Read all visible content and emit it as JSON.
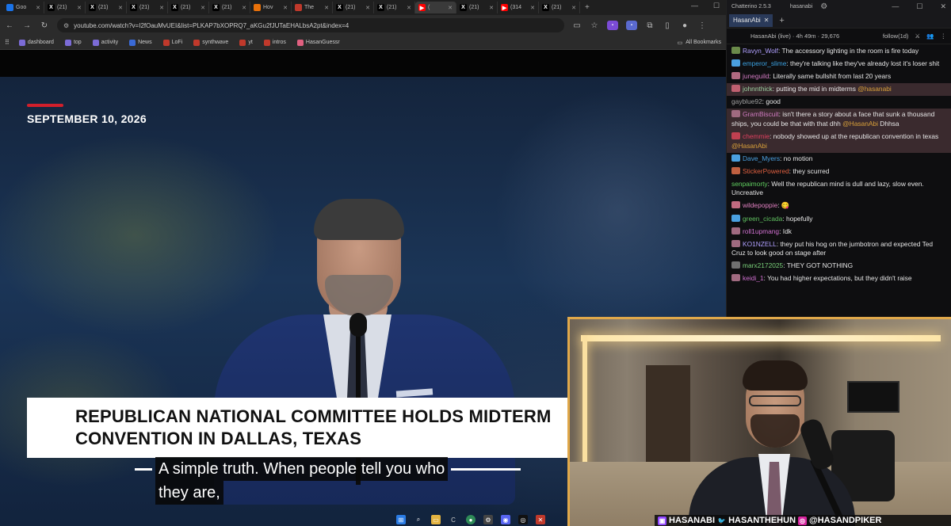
{
  "browser": {
    "tabs": [
      {
        "label": "Goo",
        "icon": "google-icon",
        "color": "#1a73e8"
      },
      {
        "label": "(21)",
        "icon": "x-icon",
        "color": "#000000"
      },
      {
        "label": "(21)",
        "icon": "x-icon",
        "color": "#000000"
      },
      {
        "label": "(21)",
        "icon": "x-icon",
        "color": "#000000"
      },
      {
        "label": "(21)",
        "icon": "x-icon",
        "color": "#000000"
      },
      {
        "label": "(21)",
        "icon": "x-icon",
        "color": "#000000"
      },
      {
        "label": "Hov",
        "icon": "orange-icon",
        "color": "#e8710a"
      },
      {
        "label": "The",
        "icon": "red-pin-icon",
        "color": "#c0392b"
      },
      {
        "label": "(21)",
        "icon": "x-icon",
        "color": "#000000"
      },
      {
        "label": "(21)",
        "icon": "x-icon",
        "color": "#000000"
      },
      {
        "label": "(",
        "icon": "youtube-icon",
        "color": "#ff0000",
        "active": true
      },
      {
        "label": "(21)",
        "icon": "x-icon",
        "color": "#000000"
      },
      {
        "label": "(314",
        "icon": "youtube-icon",
        "color": "#ff0000"
      },
      {
        "label": "(21)",
        "icon": "x-icon",
        "color": "#000000"
      }
    ],
    "url": "youtube.com/watch?v=I2fOauMvUEI&list=PLKAP7bXOPRQ7_aKGu2fJUTaEHALbsA2pt&index=4",
    "bookmarks": [
      "dashboard",
      "top",
      "activity",
      "News",
      "LoFi",
      "synthwave",
      "yt",
      "intros",
      "HasanGuessr"
    ],
    "all_bookmarks": "All Bookmarks"
  },
  "video": {
    "date": "SEPTEMBER 10, 2026",
    "lower_third": [
      "REPUBLICAN NATIONAL COMMITTEE HOLDS MIDTERM",
      "CONVENTION IN DALLAS, TEXAS"
    ],
    "caption": [
      "A simple truth. When people tell you who",
      "they are,"
    ]
  },
  "chat": {
    "app_title": "Chatterino 2.5.3",
    "account": "hasanabi",
    "tab_label": "HasanAbi",
    "header": "HasanAbi (live) · 4h 49m · 29,676",
    "follow": "follow(1d)",
    "messages": [
      {
        "user": "Ravyn_Wolf",
        "color": "#b0a0ff",
        "text": "The accessory lighting in the room is fire today",
        "badge": "#6a8a4a"
      },
      {
        "user": "emperor_slime",
        "color": "#3aa0e0",
        "text": "they're talking like they've already lost it's loser shit",
        "badge": "#4aa0e0"
      },
      {
        "user": "juneguild",
        "color": "#d07ac0",
        "text": "Literally same bullshit from last 20 years",
        "badge": "#b06a80"
      },
      {
        "user": "johnnthick",
        "color": "#9ad0a0",
        "text": "putting the mid in midterms ",
        "mention": "@hasanabi",
        "badge": "#c06070",
        "highlight": true
      },
      {
        "user": "gayblue92",
        "color": "#a0a0a0",
        "text": "good",
        "badge": ""
      },
      {
        "user": "GramBiscuit",
        "color": "#d07ac0",
        "text": "isn't there a story about a face that sunk a thousand ships, you could be that with that dhh ",
        "mention": "@HasanAbi",
        "tail": " Dhhsa",
        "badge": "#a06a80",
        "highlight": true
      },
      {
        "user": "chemmie",
        "color": "#e04060",
        "text": "nobody showed up at the republican convention in texas ",
        "mention": "@HasanAbi",
        "badge": "#c04050",
        "highlight": true
      },
      {
        "user": "Dave_Myers",
        "color": "#4aa0e0",
        "text": "no motion",
        "badge": "#4aa0e0"
      },
      {
        "user": "StickerPowered",
        "color": "#e06040",
        "text": "they scurred",
        "badge": "#c06040"
      },
      {
        "user": "senpaimorty",
        "color": "#60d060",
        "text": "Well the republican mind is dull and lazy, slow even. Uncreative",
        "badge": ""
      },
      {
        "user": "wildepoppie",
        "color": "#e080c0",
        "text": "😋",
        "badge": "#c06a80"
      },
      {
        "user": "green_cicada",
        "color": "#60c060",
        "text": "hopefully",
        "badge": "#4aa0e0"
      },
      {
        "user": "roll1upmang",
        "color": "#d070d0",
        "text": "Idk",
        "badge": "#a06a80"
      },
      {
        "user": "KO1NZELL",
        "color": "#b0a0ff",
        "text": "they put his hog on the jumbotron and expected Ted Cruz to look good on stage after",
        "badge": "#a06a80"
      },
      {
        "user": "marx2172025",
        "color": "#7ad07a",
        "text": "THEY GOT NOTHING",
        "badge": "#707070"
      },
      {
        "user": "keidi_1",
        "color": "#d070d0",
        "text": "You had higher expectations, but they didn't raise",
        "badge": "#a06a80"
      }
    ]
  },
  "overlay": {
    "twitch": "HASANABI",
    "twitter": "HASANTHEHUN",
    "instagram": "@HASANDPIKER"
  },
  "colors": {
    "accent_red": "#d21f2b",
    "frame_gold": "#e0a84a",
    "mention": "#d9a03a"
  }
}
